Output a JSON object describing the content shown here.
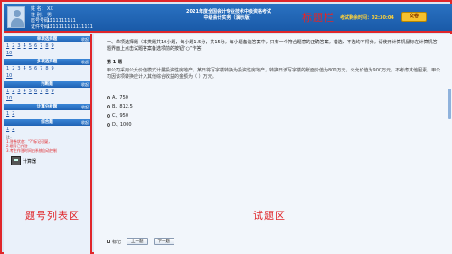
{
  "header": {
    "name_label": "姓 名：",
    "name_value": "XX",
    "gender_label": "性 别：",
    "gender_value": "男",
    "seat_label": "座号号码：",
    "seat_value": "1111111111",
    "cert_label": "证件号码：",
    "cert_value": "1111111111111111",
    "exam_title_line1": "2021年度全国会计专业技术中级资格考试",
    "exam_title_line2": "中级会计实务（演示版）",
    "title_tag": "标题栏",
    "timer_label": "考试剩余时间：",
    "timer_value": "02:30:04",
    "submit_label": "交卷"
  },
  "sidebar": {
    "fold_label": "收起",
    "sections": [
      {
        "title": "单项选择题",
        "rows": [
          [
            "1",
            "2",
            "3",
            "4",
            "5",
            "6",
            "7",
            "8",
            "9"
          ],
          [
            "10"
          ]
        ]
      },
      {
        "title": "多项选择题",
        "rows": [
          [
            "1",
            "2",
            "3",
            "4",
            "5",
            "6",
            "7",
            "8",
            "9"
          ],
          [
            "10"
          ]
        ]
      },
      {
        "title": "判断题",
        "rows": [
          [
            "1",
            "2",
            "3",
            "4",
            "5",
            "6",
            "7",
            "8",
            "9"
          ],
          [
            "10"
          ]
        ]
      },
      {
        "title": "计算分析题",
        "rows": [
          [
            "1",
            "2"
          ]
        ]
      },
      {
        "title": "综合题",
        "rows": [
          [
            "1",
            "2"
          ]
        ]
      }
    ],
    "notes_title": "注：",
    "note1": "1.答卷状态：“?”标记可疑，",
    "note2": "2.题号已作答",
    "note3": "3.考生作答时间由系统自动控制",
    "calculator_label": "计算器",
    "area_tag": "题号列表区"
  },
  "question": {
    "instruction": "一、单项选择题（本类题共10小题，每小题1.5分，共15分。每小题备选答案中，只有一个符合题意的正确答案。错选、不选均不得分。请使用计算机鼠标在计算机答题界面上点击试题答案备选项前的按钮“○”作答）",
    "number": "第 1 题",
    "stem": "甲公司采用公允价值模式计量投资性房地产，某日将写字楼转换为投资性房地产，转换日该写字楼的账面价值为800万元，公允价值为900万元，不考虑其他因素。甲公司因该项转换应计入其他综合收益的金额为（    ）万元。",
    "options": [
      {
        "label": "A、750"
      },
      {
        "label": "B、812.5"
      },
      {
        "label": "C、950"
      },
      {
        "label": "D、1000"
      }
    ],
    "area_tag": "试题区",
    "mark_label": "标记",
    "prev_label": "上一题",
    "next_label": "下一题"
  },
  "colors": {
    "accent": "#1f63b5",
    "annotation": "#e0262a",
    "timer": "#ffd23a"
  }
}
